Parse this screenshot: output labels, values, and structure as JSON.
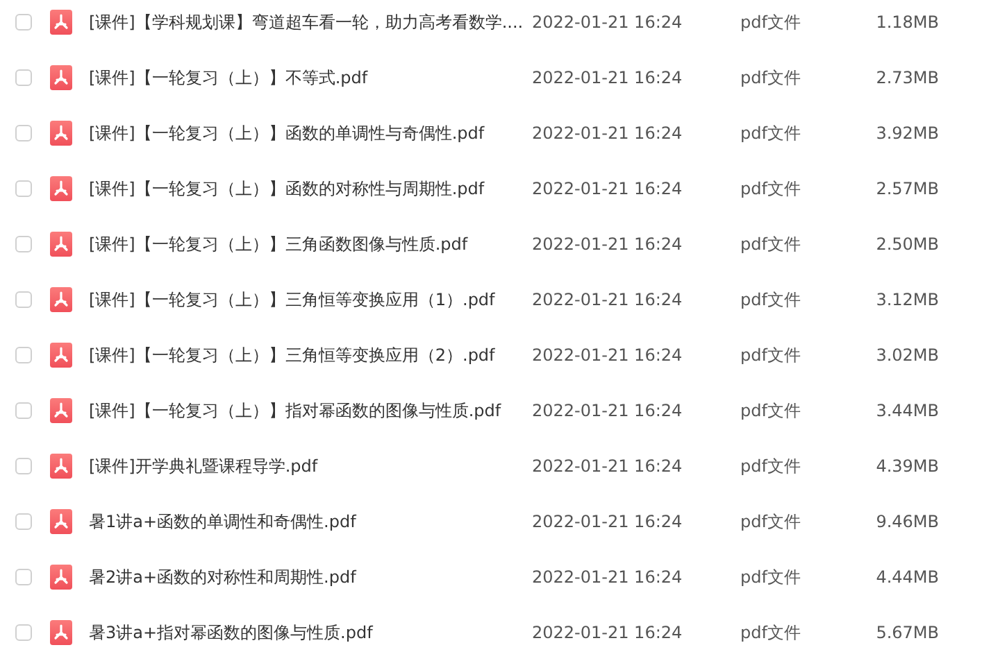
{
  "files": [
    {
      "name": "[课件]【学科规划课】弯道超车看一轮，助力高考看数学....",
      "checked": false,
      "modified": "2022-01-21 16:24",
      "type": "pdf文件",
      "size": "1.18MB"
    },
    {
      "name": "[课件]【一轮复习（上）】不等式.pdf",
      "checked": false,
      "modified": "2022-01-21 16:24",
      "type": "pdf文件",
      "size": "2.73MB"
    },
    {
      "name": "[课件]【一轮复习（上）】函数的单调性与奇偶性.pdf",
      "checked": false,
      "modified": "2022-01-21 16:24",
      "type": "pdf文件",
      "size": "3.92MB"
    },
    {
      "name": "[课件]【一轮复习（上）】函数的对称性与周期性.pdf",
      "checked": false,
      "modified": "2022-01-21 16:24",
      "type": "pdf文件",
      "size": "2.57MB"
    },
    {
      "name": "[课件]【一轮复习（上）】三角函数图像与性质.pdf",
      "checked": false,
      "modified": "2022-01-21 16:24",
      "type": "pdf文件",
      "size": "2.50MB"
    },
    {
      "name": "[课件]【一轮复习（上）】三角恒等变换应用（1）.pdf",
      "checked": false,
      "modified": "2022-01-21 16:24",
      "type": "pdf文件",
      "size": "3.12MB"
    },
    {
      "name": "[课件]【一轮复习（上）】三角恒等变换应用（2）.pdf",
      "checked": false,
      "modified": "2022-01-21 16:24",
      "type": "pdf文件",
      "size": "3.02MB"
    },
    {
      "name": "[课件]【一轮复习（上）】指对幂函数的图像与性质.pdf",
      "checked": false,
      "modified": "2022-01-21 16:24",
      "type": "pdf文件",
      "size": "3.44MB"
    },
    {
      "name": "[课件]开学典礼暨课程导学.pdf",
      "checked": false,
      "modified": "2022-01-21 16:24",
      "type": "pdf文件",
      "size": "4.39MB"
    },
    {
      "name": "暑1讲a+函数的单调性和奇偶性.pdf",
      "checked": false,
      "modified": "2022-01-21 16:24",
      "type": "pdf文件",
      "size": "9.46MB"
    },
    {
      "name": "暑2讲a+函数的对称性和周期性.pdf",
      "checked": false,
      "modified": "2022-01-21 16:24",
      "type": "pdf文件",
      "size": "4.44MB"
    },
    {
      "name": "暑3讲a+指对幂函数的图像与性质.pdf",
      "checked": false,
      "modified": "2022-01-21 16:24",
      "type": "pdf文件",
      "size": "5.67MB"
    }
  ]
}
